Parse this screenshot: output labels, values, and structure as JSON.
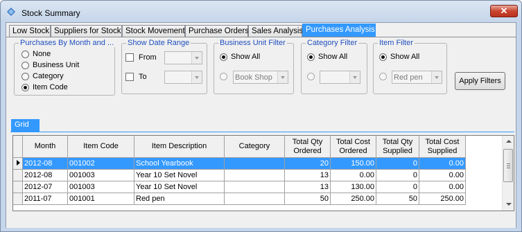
{
  "window": {
    "title": "Stock Summary",
    "close_label": "✕"
  },
  "tabs": [
    {
      "label": "Low Stock",
      "active": false
    },
    {
      "label": "Suppliers for Stock",
      "active": false
    },
    {
      "label": "Stock Movement",
      "active": false
    },
    {
      "label": "Purchase Orders",
      "active": false
    },
    {
      "label": "Sales Analysis",
      "active": false
    },
    {
      "label": "Purchases Analysis",
      "active": true
    }
  ],
  "filters": {
    "purchases_by": {
      "legend": "Purchases By Month and ...",
      "options": [
        "None",
        "Business Unit",
        "Category",
        "Item Code"
      ],
      "selected": "Item Code"
    },
    "date_range": {
      "legend": "Show Date Range",
      "from_label": "From",
      "to_label": "To",
      "from_value": "",
      "to_value": ""
    },
    "business_unit": {
      "legend": "Business Unit Filter",
      "show_all": "Show All",
      "combo_value": "Book Shop"
    },
    "category": {
      "legend": "Category Filter",
      "show_all": "Show All",
      "combo_value": ""
    },
    "item": {
      "legend": "Item Filter",
      "show_all": "Show All",
      "combo_value": "Red pen"
    },
    "apply_label": "Apply Filters"
  },
  "grid": {
    "tab_label": "Grid",
    "columns": [
      "Month",
      "Item Code",
      "Item Description",
      "Category",
      "Total Qty Ordered",
      "Total Cost Ordered",
      "Total Qty Supplied",
      "Total Cost Supplied"
    ],
    "rows": [
      {
        "month": "2012-08",
        "item_code": "001002",
        "description": "School Yearbook",
        "category": "",
        "qty_ordered": "20",
        "cost_ordered": "150.00",
        "qty_supplied": "0",
        "cost_supplied": "0.00",
        "selected": true
      },
      {
        "month": "2012-08",
        "item_code": "001003",
        "description": "Year 10 Set Novel",
        "category": "",
        "qty_ordered": "13",
        "cost_ordered": "0.00",
        "qty_supplied": "0",
        "cost_supplied": "0.00",
        "selected": false
      },
      {
        "month": "2012-07",
        "item_code": "001003",
        "description": "Year 10 Set Novel",
        "category": "",
        "qty_ordered": "13",
        "cost_ordered": "130.00",
        "qty_supplied": "0",
        "cost_supplied": "0.00",
        "selected": false
      },
      {
        "month": "2011-07",
        "item_code": "001001",
        "description": "Red pen",
        "category": "",
        "qty_ordered": "50",
        "cost_ordered": "250.00",
        "qty_supplied": "50",
        "cost_supplied": "250.00",
        "selected": false
      }
    ]
  },
  "colors": {
    "accent": "#3399ff",
    "legend_text": "#1f4ebe",
    "close_button": "#c9452f"
  }
}
